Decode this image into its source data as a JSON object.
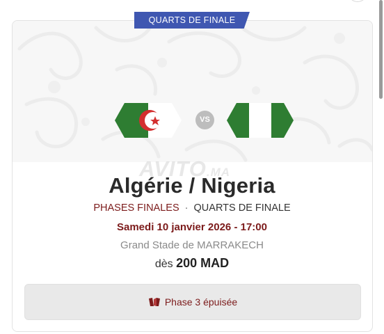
{
  "stage_badge": "QUARTS DE FINALE",
  "match": {
    "title": "Algérie / Nigeria",
    "home_team_icon": "algeria-flag-icon",
    "away_team_icon": "nigeria-flag-icon",
    "vs_label": "VS"
  },
  "watermark": {
    "brand": "AVITO",
    "suffix": ".MA"
  },
  "phase": {
    "group": "PHASES FINALES",
    "separator": "·",
    "round": "QUARTS DE FINALE"
  },
  "datetime": "Samedi 10 janvier 2026 - 17:00",
  "venue": "Grand Stade de MARRAKECH",
  "price": {
    "prefix": "dès",
    "amount": "200 MAD"
  },
  "status": {
    "label": "Phase 3 épuisée",
    "icon": "ticket-icon"
  },
  "colors": {
    "badge": "#3f57b1",
    "accent": "#7c1b1b",
    "algeria_green": "#2e7d32",
    "algeria_red": "#d32f2f",
    "nigeria_green": "#2e7d32"
  }
}
